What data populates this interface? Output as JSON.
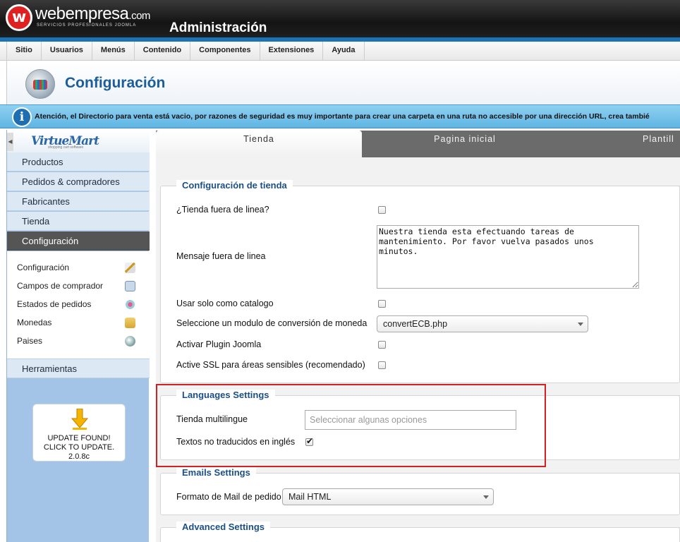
{
  "brand": {
    "logo_letter": "w",
    "name": "webempresa",
    "tld": ".com",
    "tagline": "SERVICIOS PROFESIONALES JOOMLA",
    "admin_title": "Administración"
  },
  "menu": [
    {
      "label": "Sitio"
    },
    {
      "label": "Usuarios"
    },
    {
      "label": "Menús"
    },
    {
      "label": "Contenido"
    },
    {
      "label": "Componentes"
    },
    {
      "label": "Extensiones"
    },
    {
      "label": "Ayuda"
    }
  ],
  "page": {
    "title": "Configuración"
  },
  "notice": {
    "icon_text": "i",
    "text": "Atención, el Directorio para venta está vacio, por razones de seguridad es muy importante para crear una carpeta en una ruta no accesible por una dirección URL, crea tambié"
  },
  "sidebar": {
    "logo": "VirtueMart",
    "logo_sub": "shopping cart software",
    "items": [
      {
        "label": "Productos"
      },
      {
        "label": "Pedidos & compradores"
      },
      {
        "label": "Fabricantes"
      },
      {
        "label": "Tienda"
      },
      {
        "label": "Configuración",
        "active": true
      }
    ],
    "subitems": [
      {
        "label": "Configuración",
        "icon": "wrench-icon"
      },
      {
        "label": "Campos de comprador",
        "icon": "form-icon"
      },
      {
        "label": "Estados de pedidos",
        "icon": "status-icon"
      },
      {
        "label": "Monedas",
        "icon": "coins-icon"
      },
      {
        "label": "Paises",
        "icon": "globe-icon"
      }
    ],
    "tools": "Herramientas",
    "update": {
      "line1": "UPDATE FOUND!",
      "line2": "CLICK TO UPDATE.",
      "version": "2.0.8c"
    }
  },
  "tabs": [
    {
      "label": "Tienda",
      "active": true
    },
    {
      "label": "Pagina inicial"
    },
    {
      "label": "Plantill"
    }
  ],
  "shop_config": {
    "legend": "Configuración de tienda",
    "offline_label": "¿Tienda fuera de linea?",
    "offline_checked": false,
    "offline_msg_label": "Mensaje fuera de linea",
    "offline_msg_value": "Nuestra tienda esta efectuando tareas de mantenimiento. Por favor vuelva pasados unos minutos.",
    "catalog_label": "Usar solo como catalogo",
    "catalog_checked": false,
    "currency_module_label": "Seleccione un modulo de conversión de moneda",
    "currency_module_value": "convertECB.php",
    "plugin_label": "Activar Plugin Joomla",
    "plugin_checked": false,
    "ssl_label": "Active SSL para áreas sensibles (recomendado)",
    "ssl_checked": false
  },
  "languages": {
    "legend": "Languages Settings",
    "multilang_label": "Tienda multilingue",
    "multilang_placeholder": "Seleccionar algunas opciones",
    "untranslated_label": "Textos no traducidos en inglés",
    "untranslated_checked": true
  },
  "emails": {
    "legend": "Emails Settings",
    "format_label": "Formato de Mail de pedido",
    "format_value": "Mail HTML"
  },
  "advanced": {
    "legend": "Advanced Settings"
  },
  "colors": {
    "header_bg": "#1a1a1a",
    "accent_blue": "#1b73b5",
    "title_blue": "#1b5e9a",
    "sidebar_bg": "#a3c4e6",
    "notice_bg": "#7ec6ed",
    "highlight_red": "#d42020"
  }
}
